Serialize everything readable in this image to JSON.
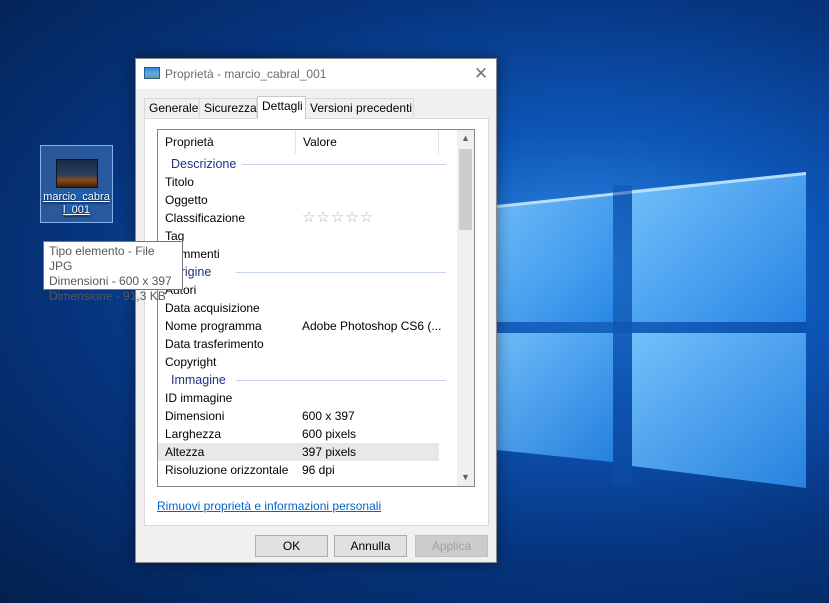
{
  "desktop": {
    "icon_label": "marcio_cabral_001",
    "tooltip": {
      "line1": "Tipo elemento - File JPG",
      "line2": "Dimensioni - 600 x 397",
      "line3": "Dimensione - 91,3 KB"
    }
  },
  "dialog": {
    "title": "Proprietà - marcio_cabral_001",
    "close_glyph": "✕",
    "tabs": [
      "Generale",
      "Sicurezza",
      "Dettagli",
      "Versioni precedenti"
    ],
    "active_tab": "Dettagli",
    "columns": {
      "property": "Proprietà",
      "value": "Valore"
    },
    "groups": [
      {
        "label": "Descrizione",
        "rows": [
          {
            "name": "Titolo",
            "value": ""
          },
          {
            "name": "Oggetto",
            "value": ""
          },
          {
            "name": "Classificazione",
            "value": "☆☆☆☆☆",
            "stars": true
          },
          {
            "name": "Tag",
            "value": ""
          },
          {
            "name": "Commenti",
            "value": ""
          }
        ]
      },
      {
        "label": "Origine",
        "rows": [
          {
            "name": "Autori",
            "value": ""
          },
          {
            "name": "Data acquisizione",
            "value": ""
          },
          {
            "name": "Nome programma",
            "value": "Adobe Photoshop CS6 (..."
          },
          {
            "name": "Data trasferimento",
            "value": ""
          },
          {
            "name": "Copyright",
            "value": ""
          }
        ]
      },
      {
        "label": "Immagine",
        "rows": [
          {
            "name": "ID immagine",
            "value": ""
          },
          {
            "name": "Dimensioni",
            "value": "600 x 397"
          },
          {
            "name": "Larghezza",
            "value": "600 pixels"
          },
          {
            "name": "Altezza",
            "value": "397 pixels",
            "selected": true
          },
          {
            "name": "Risoluzione orizzontale",
            "value": "96 dpi"
          }
        ]
      }
    ],
    "scroll_up": "▲",
    "scroll_down": "▼",
    "remove_link": "Rimuovi proprietà e informazioni personali",
    "buttons": {
      "ok": "OK",
      "cancel": "Annulla",
      "apply": "Applica"
    }
  }
}
